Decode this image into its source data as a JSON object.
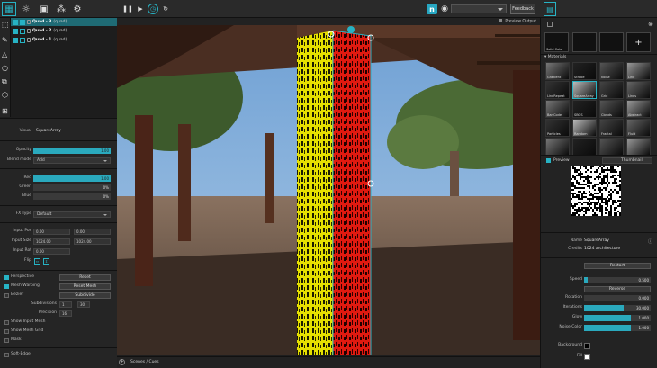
{
  "layers": [
    {
      "name": "Quad - 3",
      "suffix": "(quad)",
      "selected": true
    },
    {
      "name": "Quad - 2",
      "suffix": "(quad)",
      "selected": false
    },
    {
      "name": "Quad - 1",
      "suffix": "(quad)",
      "selected": false
    }
  ],
  "viewport": {
    "preview_label": "Preview Output"
  },
  "scenes_label": "Scenes / Cues",
  "left": {
    "visual_label": "Visual",
    "visual_value": "SquareArray",
    "opacity_label": "Opacity",
    "opacity_value": "1.00",
    "opacity_fill": 1.0,
    "blend_label": "Blend mode",
    "blend_value": "Add",
    "red_label": "Red",
    "red_value": "1.00",
    "red_fill": 1.0,
    "green_label": "Green",
    "green_value": "0%",
    "blue_label": "Blue",
    "blue_value": "0%",
    "fx_label": "FX Type",
    "fx_value": "Default",
    "input_pos_label": "Input Pos",
    "input_pos_x": "0.00",
    "input_pos_y": "0.00",
    "input_size_label": "Input Size",
    "input_size_w": "1024.00",
    "input_size_h": "1024.00",
    "input_rot_label": "Input Rot",
    "input_rot_value": "0.00",
    "flip_label": "Flip",
    "perspective_label": "Perspective",
    "reset_label": "Reset",
    "mesh_warping_label": "Mesh Warping",
    "reset_mesh_label": "Reset Mesh",
    "bezier_label": "Bezier",
    "subdivide_label": "Subdivide",
    "subdivisions_label": "Subdivisions",
    "subdiv_a": "1",
    "subdiv_b": "30",
    "precision_label": "Precision",
    "precision_value": "16",
    "show_input_mesh_label": "Show Input Mesh",
    "show_mesh_grid_label": "Show Mesh Grid",
    "mask_label": "Mask",
    "soft_edge_label": "Soft-Edge"
  },
  "right": {
    "solid_color_label": "Solid Color",
    "materials_header": "Materials",
    "materials": [
      "Gradient",
      "Strobe",
      "Noise",
      "Line",
      "LineRepeat",
      "SquareArray",
      "Grid",
      "Lines",
      "Bar Code",
      "SBOS",
      "Clouds",
      "Abstract",
      "Particles",
      "Random",
      "Fractal",
      "Fluid",
      "",
      "",
      "",
      ""
    ],
    "preview_header": "Preview",
    "preview_mode": "Thumbnail",
    "name_label": "Name",
    "name_value": "SquareArray",
    "credits_label": "Credits",
    "credits_value": "1024 architecture",
    "restart_label": "Restart",
    "speed_label": "Speed",
    "speed_value": "0.500",
    "speed_fill": 0.1,
    "reverse_label": "Reverse",
    "rotation_label": "Rotation",
    "rotation_value": "0.000",
    "iterations_label": "Iterations",
    "iterations_value": "30.000",
    "glow_label": "Glow",
    "glow_value": "1.000",
    "noise_color_label": "Noise Color",
    "noise_color_value": "1.000",
    "background_label": "Background",
    "fill_label": "Fill"
  }
}
